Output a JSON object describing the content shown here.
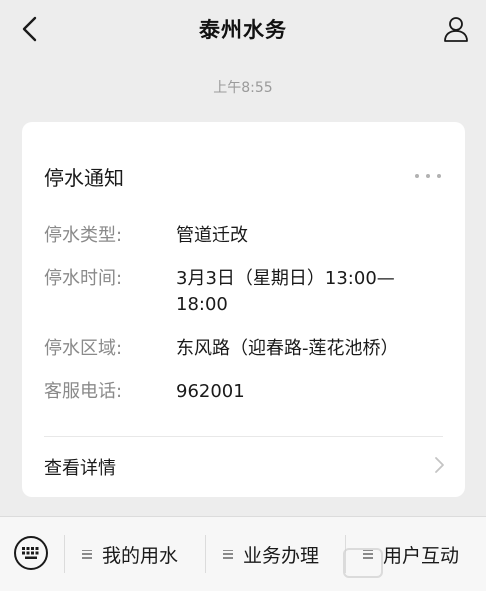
{
  "header": {
    "title": "泰州水务",
    "back_icon": "chevron-left-icon",
    "profile_icon": "person-icon"
  },
  "message": {
    "time": "上午8:55"
  },
  "card": {
    "title": "停水通知",
    "more_icon": "more-dots-icon",
    "rows": [
      {
        "label": "停水类型:",
        "value": "管道迁改"
      },
      {
        "label": "停水时间:",
        "value": "3月3日（星期日）13:00—18:00"
      },
      {
        "label": "停水区域:",
        "value": "东风路（迎春路-莲花池桥）"
      },
      {
        "label": "客服电话:",
        "value": "962001"
      }
    ],
    "detail_link": "查看详情"
  },
  "bottom_menu": {
    "keyboard_icon": "keyboard-icon",
    "items": [
      {
        "label": "我的用水"
      },
      {
        "label": "业务办理"
      },
      {
        "label": "用户互动"
      }
    ]
  }
}
